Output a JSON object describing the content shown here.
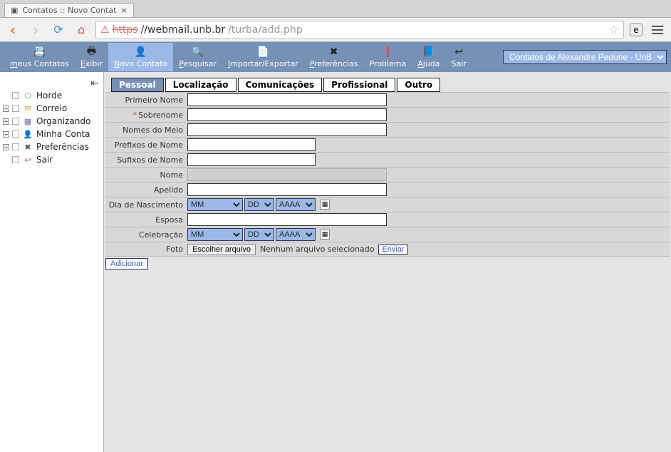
{
  "browser": {
    "tab_title": "Contatos :: Novo Contat",
    "url_scheme": "https",
    "url_host": "//webmail.unb.br",
    "url_path": "/turba/add.php"
  },
  "toolbar": {
    "items": [
      {
        "key": "m",
        "rest": "eus Contatos",
        "icon": "📇"
      },
      {
        "key": "E",
        "rest": "xibir",
        "icon": "🖶"
      },
      {
        "key": "N",
        "rest": "ovo Contato",
        "icon": "👤",
        "active": true
      },
      {
        "key": "P",
        "rest": "esquisar",
        "icon": "🔍"
      },
      {
        "key": "I",
        "rest": "mportar/Exportar",
        "icon": "📄"
      },
      {
        "key": "P",
        "rest": "referências",
        "icon": "✖"
      },
      {
        "key": "",
        "rest": "Problema",
        "icon": "❗"
      },
      {
        "key": "A",
        "rest": "juda",
        "icon": "📘"
      },
      {
        "key": "",
        "rest": "Sair",
        "icon": "↩"
      }
    ],
    "addressbook_selected": "Contatos de Alexandre Pedone - UnB"
  },
  "sidebar": {
    "items": [
      {
        "label": "Horde",
        "icon": "⎔",
        "cls": "ic-horde",
        "expandable": false
      },
      {
        "label": "Correio",
        "icon": "✉",
        "cls": "ic-mail",
        "expandable": true
      },
      {
        "label": "Organizando",
        "icon": "▦",
        "cls": "ic-org",
        "expandable": true
      },
      {
        "label": "Minha Conta",
        "icon": "👤",
        "cls": "ic-acct",
        "expandable": true
      },
      {
        "label": "Preferências",
        "icon": "✖",
        "cls": "ic-pref",
        "expandable": true
      },
      {
        "label": "Sair",
        "icon": "↩",
        "cls": "ic-exit",
        "expandable": false
      }
    ]
  },
  "tabs": [
    "Pessoal",
    "Localização",
    "Comunicações",
    "Profissional",
    "Outro"
  ],
  "form": {
    "labels": {
      "first": "Primeiro Nome",
      "last": "Sobrenome",
      "middle": "Nomes do Meio",
      "prefix": "Prefixos de Nome",
      "suffix": "Sufixos de Nome",
      "name": "Nome",
      "nick": "Apelido",
      "birth": "Dia de Nascimento",
      "spouse": "Esposa",
      "anniv": "Celebração",
      "photo": "Foto"
    },
    "required_marker": "*",
    "date": {
      "mm": "MM",
      "dd": "DD",
      "yyyy": "AAAA"
    },
    "file": {
      "choose": "Escolher arquivo",
      "none": "Nenhum arquivo selecionado",
      "send": "Enviar"
    },
    "add": "Adicionar"
  }
}
